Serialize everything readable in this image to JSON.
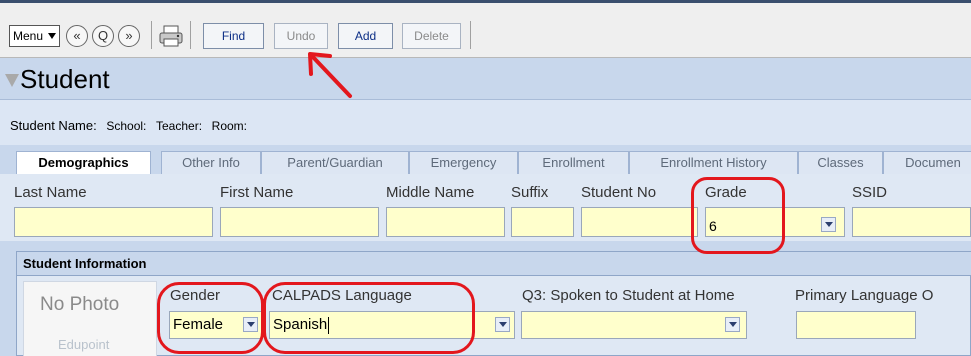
{
  "toolbar": {
    "menu_label": "Menu",
    "prev_label": "«",
    "search_label": "Q",
    "next_label": "»",
    "buttons": [
      {
        "label": "Find"
      },
      {
        "label": "Undo"
      },
      {
        "label": "Add"
      },
      {
        "label": "Delete"
      }
    ]
  },
  "page": {
    "title": "Student"
  },
  "info": {
    "student_name_label": "Student Name:",
    "school_label": "School:",
    "teacher_label": "Teacher:",
    "room_label": "Room:"
  },
  "tabs": [
    {
      "label": "Demographics",
      "active": true
    },
    {
      "label": "Other Info"
    },
    {
      "label": "Parent/Guardian"
    },
    {
      "label": "Emergency"
    },
    {
      "label": "Enrollment"
    },
    {
      "label": "Enrollment History"
    },
    {
      "label": "Classes"
    },
    {
      "label": "Documen"
    }
  ],
  "fields": {
    "last_name": {
      "label": "Last Name",
      "value": ""
    },
    "first_name": {
      "label": "First Name",
      "value": ""
    },
    "middle_name": {
      "label": "Middle Name",
      "value": ""
    },
    "suffix": {
      "label": "Suffix",
      "value": ""
    },
    "student_no": {
      "label": "Student No",
      "value": ""
    },
    "grade": {
      "label": "Grade",
      "value": "6"
    },
    "ssid": {
      "label": "SSID",
      "value": ""
    }
  },
  "section": {
    "title": "Student Information",
    "photo_text": "No Photo",
    "photo_logo": "Edupoint",
    "gender": {
      "label": "Gender",
      "value": "Female"
    },
    "calpads_language": {
      "label": "CALPADS Language",
      "value": "Spanish"
    },
    "q3": {
      "label": "Q3: Spoken to Student at Home",
      "value": ""
    },
    "primary_language": {
      "label": "Primary Language O",
      "value": ""
    }
  },
  "colors": {
    "highlight": "#e3171d",
    "field_background": "#ffffcc",
    "header_background": "#c8d7ec"
  },
  "icons": {
    "menu": "chevron-down-icon",
    "prev": "rewind-icon",
    "search": "search-icon",
    "next": "fast-forward-icon",
    "print": "printer-icon",
    "filter": "filter-icon",
    "annotation": "arrow-icon"
  }
}
